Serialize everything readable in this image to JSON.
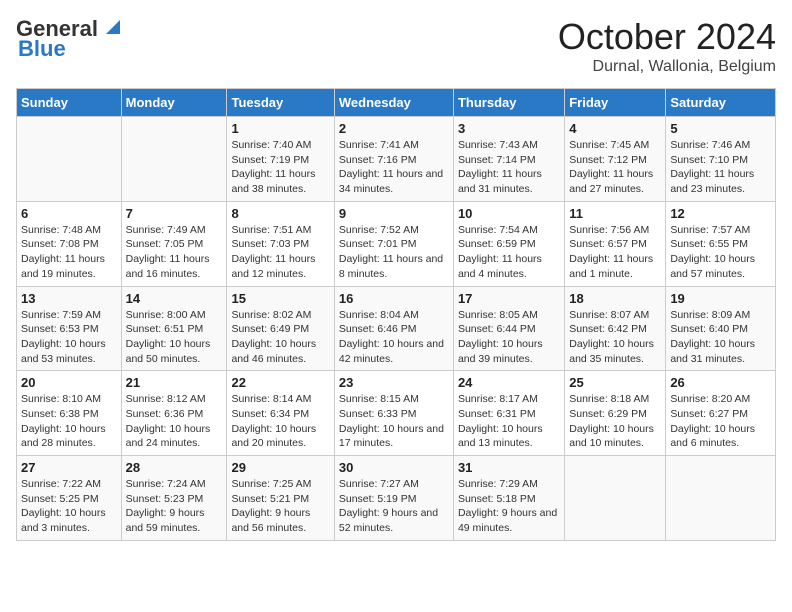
{
  "header": {
    "logo_line1": "General",
    "logo_line2": "Blue",
    "title": "October 2024",
    "subtitle": "Durnal, Wallonia, Belgium"
  },
  "days_of_week": [
    "Sunday",
    "Monday",
    "Tuesday",
    "Wednesday",
    "Thursday",
    "Friday",
    "Saturday"
  ],
  "weeks": [
    [
      {
        "day": "",
        "sunrise": "",
        "sunset": "",
        "daylight": ""
      },
      {
        "day": "",
        "sunrise": "",
        "sunset": "",
        "daylight": ""
      },
      {
        "day": "1",
        "sunrise": "Sunrise: 7:40 AM",
        "sunset": "Sunset: 7:19 PM",
        "daylight": "Daylight: 11 hours and 38 minutes."
      },
      {
        "day": "2",
        "sunrise": "Sunrise: 7:41 AM",
        "sunset": "Sunset: 7:16 PM",
        "daylight": "Daylight: 11 hours and 34 minutes."
      },
      {
        "day": "3",
        "sunrise": "Sunrise: 7:43 AM",
        "sunset": "Sunset: 7:14 PM",
        "daylight": "Daylight: 11 hours and 31 minutes."
      },
      {
        "day": "4",
        "sunrise": "Sunrise: 7:45 AM",
        "sunset": "Sunset: 7:12 PM",
        "daylight": "Daylight: 11 hours and 27 minutes."
      },
      {
        "day": "5",
        "sunrise": "Sunrise: 7:46 AM",
        "sunset": "Sunset: 7:10 PM",
        "daylight": "Daylight: 11 hours and 23 minutes."
      }
    ],
    [
      {
        "day": "6",
        "sunrise": "Sunrise: 7:48 AM",
        "sunset": "Sunset: 7:08 PM",
        "daylight": "Daylight: 11 hours and 19 minutes."
      },
      {
        "day": "7",
        "sunrise": "Sunrise: 7:49 AM",
        "sunset": "Sunset: 7:05 PM",
        "daylight": "Daylight: 11 hours and 16 minutes."
      },
      {
        "day": "8",
        "sunrise": "Sunrise: 7:51 AM",
        "sunset": "Sunset: 7:03 PM",
        "daylight": "Daylight: 11 hours and 12 minutes."
      },
      {
        "day": "9",
        "sunrise": "Sunrise: 7:52 AM",
        "sunset": "Sunset: 7:01 PM",
        "daylight": "Daylight: 11 hours and 8 minutes."
      },
      {
        "day": "10",
        "sunrise": "Sunrise: 7:54 AM",
        "sunset": "Sunset: 6:59 PM",
        "daylight": "Daylight: 11 hours and 4 minutes."
      },
      {
        "day": "11",
        "sunrise": "Sunrise: 7:56 AM",
        "sunset": "Sunset: 6:57 PM",
        "daylight": "Daylight: 11 hours and 1 minute."
      },
      {
        "day": "12",
        "sunrise": "Sunrise: 7:57 AM",
        "sunset": "Sunset: 6:55 PM",
        "daylight": "Daylight: 10 hours and 57 minutes."
      }
    ],
    [
      {
        "day": "13",
        "sunrise": "Sunrise: 7:59 AM",
        "sunset": "Sunset: 6:53 PM",
        "daylight": "Daylight: 10 hours and 53 minutes."
      },
      {
        "day": "14",
        "sunrise": "Sunrise: 8:00 AM",
        "sunset": "Sunset: 6:51 PM",
        "daylight": "Daylight: 10 hours and 50 minutes."
      },
      {
        "day": "15",
        "sunrise": "Sunrise: 8:02 AM",
        "sunset": "Sunset: 6:49 PM",
        "daylight": "Daylight: 10 hours and 46 minutes."
      },
      {
        "day": "16",
        "sunrise": "Sunrise: 8:04 AM",
        "sunset": "Sunset: 6:46 PM",
        "daylight": "Daylight: 10 hours and 42 minutes."
      },
      {
        "day": "17",
        "sunrise": "Sunrise: 8:05 AM",
        "sunset": "Sunset: 6:44 PM",
        "daylight": "Daylight: 10 hours and 39 minutes."
      },
      {
        "day": "18",
        "sunrise": "Sunrise: 8:07 AM",
        "sunset": "Sunset: 6:42 PM",
        "daylight": "Daylight: 10 hours and 35 minutes."
      },
      {
        "day": "19",
        "sunrise": "Sunrise: 8:09 AM",
        "sunset": "Sunset: 6:40 PM",
        "daylight": "Daylight: 10 hours and 31 minutes."
      }
    ],
    [
      {
        "day": "20",
        "sunrise": "Sunrise: 8:10 AM",
        "sunset": "Sunset: 6:38 PM",
        "daylight": "Daylight: 10 hours and 28 minutes."
      },
      {
        "day": "21",
        "sunrise": "Sunrise: 8:12 AM",
        "sunset": "Sunset: 6:36 PM",
        "daylight": "Daylight: 10 hours and 24 minutes."
      },
      {
        "day": "22",
        "sunrise": "Sunrise: 8:14 AM",
        "sunset": "Sunset: 6:34 PM",
        "daylight": "Daylight: 10 hours and 20 minutes."
      },
      {
        "day": "23",
        "sunrise": "Sunrise: 8:15 AM",
        "sunset": "Sunset: 6:33 PM",
        "daylight": "Daylight: 10 hours and 17 minutes."
      },
      {
        "day": "24",
        "sunrise": "Sunrise: 8:17 AM",
        "sunset": "Sunset: 6:31 PM",
        "daylight": "Daylight: 10 hours and 13 minutes."
      },
      {
        "day": "25",
        "sunrise": "Sunrise: 8:18 AM",
        "sunset": "Sunset: 6:29 PM",
        "daylight": "Daylight: 10 hours and 10 minutes."
      },
      {
        "day": "26",
        "sunrise": "Sunrise: 8:20 AM",
        "sunset": "Sunset: 6:27 PM",
        "daylight": "Daylight: 10 hours and 6 minutes."
      }
    ],
    [
      {
        "day": "27",
        "sunrise": "Sunrise: 7:22 AM",
        "sunset": "Sunset: 5:25 PM",
        "daylight": "Daylight: 10 hours and 3 minutes."
      },
      {
        "day": "28",
        "sunrise": "Sunrise: 7:24 AM",
        "sunset": "Sunset: 5:23 PM",
        "daylight": "Daylight: 9 hours and 59 minutes."
      },
      {
        "day": "29",
        "sunrise": "Sunrise: 7:25 AM",
        "sunset": "Sunset: 5:21 PM",
        "daylight": "Daylight: 9 hours and 56 minutes."
      },
      {
        "day": "30",
        "sunrise": "Sunrise: 7:27 AM",
        "sunset": "Sunset: 5:19 PM",
        "daylight": "Daylight: 9 hours and 52 minutes."
      },
      {
        "day": "31",
        "sunrise": "Sunrise: 7:29 AM",
        "sunset": "Sunset: 5:18 PM",
        "daylight": "Daylight: 9 hours and 49 minutes."
      },
      {
        "day": "",
        "sunrise": "",
        "sunset": "",
        "daylight": ""
      },
      {
        "day": "",
        "sunrise": "",
        "sunset": "",
        "daylight": ""
      }
    ]
  ]
}
